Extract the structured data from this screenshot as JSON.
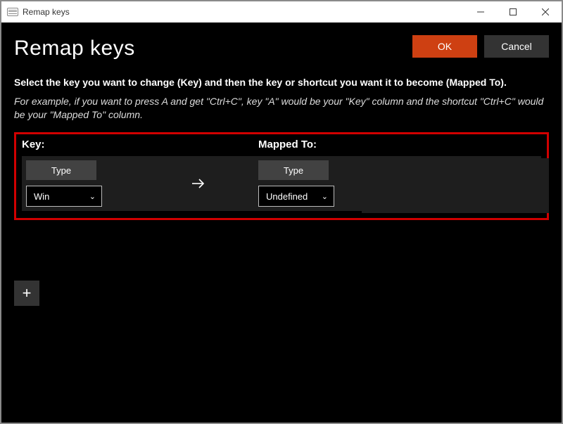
{
  "titlebar": {
    "title": "Remap keys"
  },
  "header": {
    "page_title": "Remap keys"
  },
  "buttons": {
    "ok": "OK",
    "cancel": "Cancel"
  },
  "text": {
    "instructions": "Select the key you want to change (Key) and then the key or shortcut you want it to become (Mapped To).",
    "example": "For example, if you want to press A and get \"Ctrl+C\", key \"A\" would be your \"Key\" column and the shortcut \"Ctrl+C\" would be your \"Mapped To\" column."
  },
  "columns": {
    "key": "Key:",
    "mapped": "Mapped To:"
  },
  "row": {
    "key_type_label": "Type",
    "key_select_value": "Win",
    "mapped_type_label": "Type",
    "mapped_select_value": "Undefined"
  },
  "icons": {
    "plus": "+"
  }
}
